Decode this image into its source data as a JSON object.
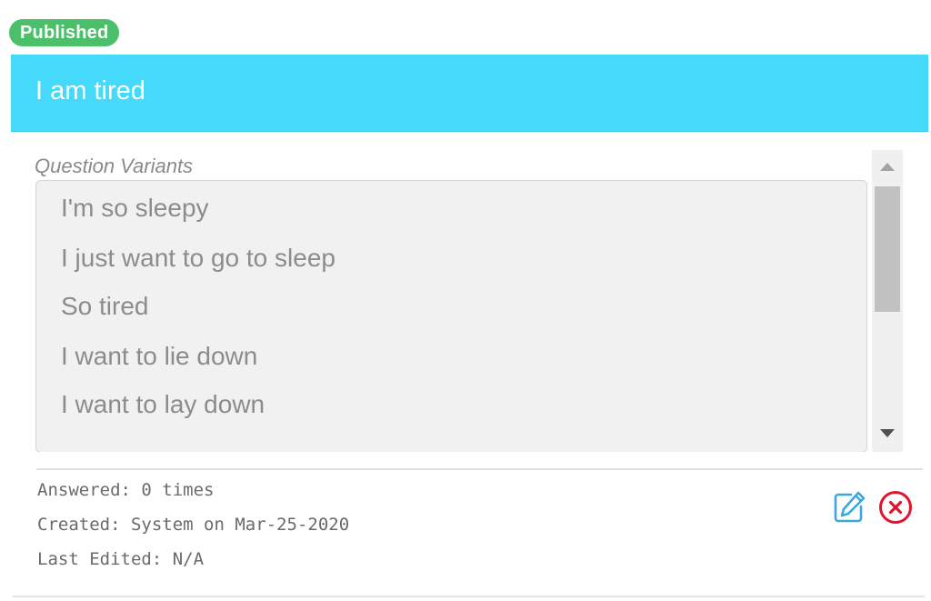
{
  "status": {
    "label": "Published",
    "color": "#4cbf6b"
  },
  "card": {
    "title": "I am tired",
    "header_color": "#45d9fb"
  },
  "variants": {
    "label": "Question Variants",
    "items": [
      "I'm so sleepy",
      "I just want to go to sleep",
      "So tired",
      "I want to lie down",
      "I want to lay down"
    ]
  },
  "meta": {
    "answered": "Answered: 0 times",
    "created": "Created: System on Mar-25-2020",
    "last_edited": "Last Edited: N/A"
  },
  "actions": {
    "edit_icon": "edit-icon",
    "delete_icon": "delete-icon",
    "edit_color": "#3aa7e0",
    "delete_color": "#e0142d"
  }
}
